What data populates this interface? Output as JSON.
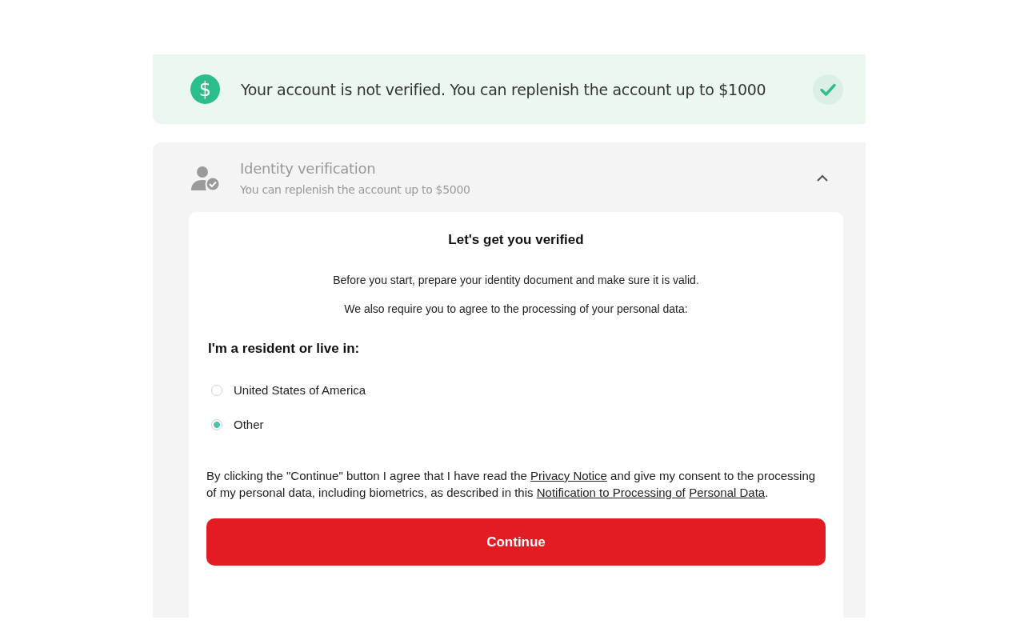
{
  "banner": {
    "symbol": "$",
    "text": "Your account is not verified. You can replenish the account up to $1000"
  },
  "identity": {
    "title": "Identity verification",
    "subtitle": "You can replenish the account up to $5000",
    "expanded": true
  },
  "card": {
    "title": "Let's get you verified",
    "paragraphs": [
      "Before you start, prepare your identity document and make sure it is valid.",
      "We also require you to agree to the processing of your personal data:"
    ],
    "question": "I'm a resident or live in:",
    "options": [
      {
        "label": "United States of America",
        "selected": false
      },
      {
        "label": "Other",
        "selected": true
      }
    ],
    "consent": [
      {
        "kind": "text",
        "text": "By clicking the \"Continue\" button I agree that I have read the "
      },
      {
        "kind": "link",
        "text": "Privacy Notice"
      },
      {
        "kind": "text",
        "text": " and give my consent to the processing of my personal data, including biometrics, as described in this "
      },
      {
        "kind": "link",
        "text": "Notification to Processing of"
      },
      {
        "kind": "link",
        "text": "Personal Data"
      },
      {
        "kind": "text",
        "text": "."
      }
    ],
    "button": "Continue"
  }
}
